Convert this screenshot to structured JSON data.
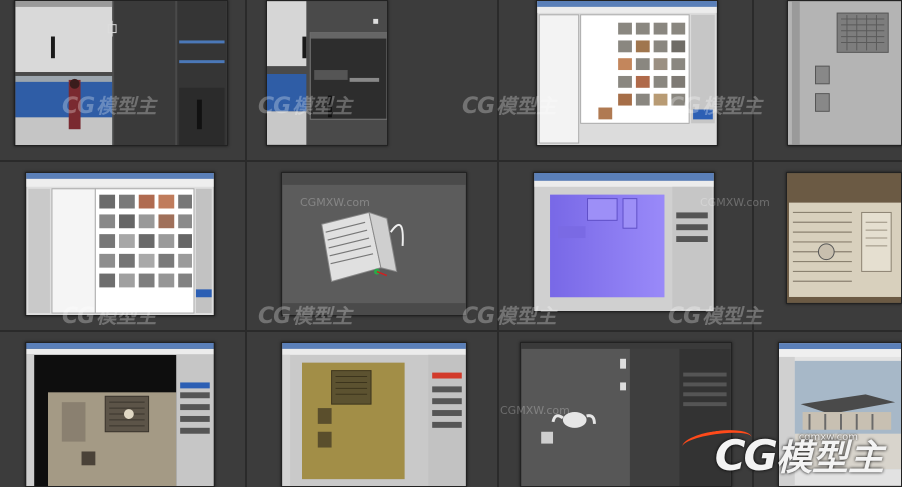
{
  "watermark": {
    "cg": "CG",
    "text": "模型主",
    "url": "CGMXW.com"
  },
  "brand": {
    "cg": "CG",
    "text": "模型主",
    "url": "cgmxw.com"
  },
  "colors": {
    "background": "#3c3c3c",
    "photoshop_bg": "#c9c9c9",
    "max_bg": "#595959",
    "normal_map": "#8a7cf0",
    "brand_accent": "#ff4a1a"
  },
  "tiles": [
    {
      "name": "tile-3dsmax-character-viewports",
      "kind": "max-viewports"
    },
    {
      "name": "tile-3dsmax-character-dialog",
      "kind": "max-dialog"
    },
    {
      "name": "tile-texture-browser-grid",
      "kind": "texture-browser"
    },
    {
      "name": "tile-ac-unit-grey-closeup",
      "kind": "grey-texture"
    },
    {
      "name": "tile-texture-browser-grid-2",
      "kind": "texture-browser-2"
    },
    {
      "name": "tile-ac-unit-model-viewport",
      "kind": "ac-model"
    },
    {
      "name": "tile-normal-map-photoshop",
      "kind": "normal-map"
    },
    {
      "name": "tile-ac-unit-photo-closeup",
      "kind": "ac-photo"
    },
    {
      "name": "tile-ac-texture-dark-photoshop",
      "kind": "ac-dark"
    },
    {
      "name": "tile-ac-texture-yellow-photoshop",
      "kind": "ac-yellow"
    },
    {
      "name": "tile-3dsmax-teapot-viewport",
      "kind": "teapot"
    },
    {
      "name": "tile-building-viewport",
      "kind": "building"
    }
  ]
}
